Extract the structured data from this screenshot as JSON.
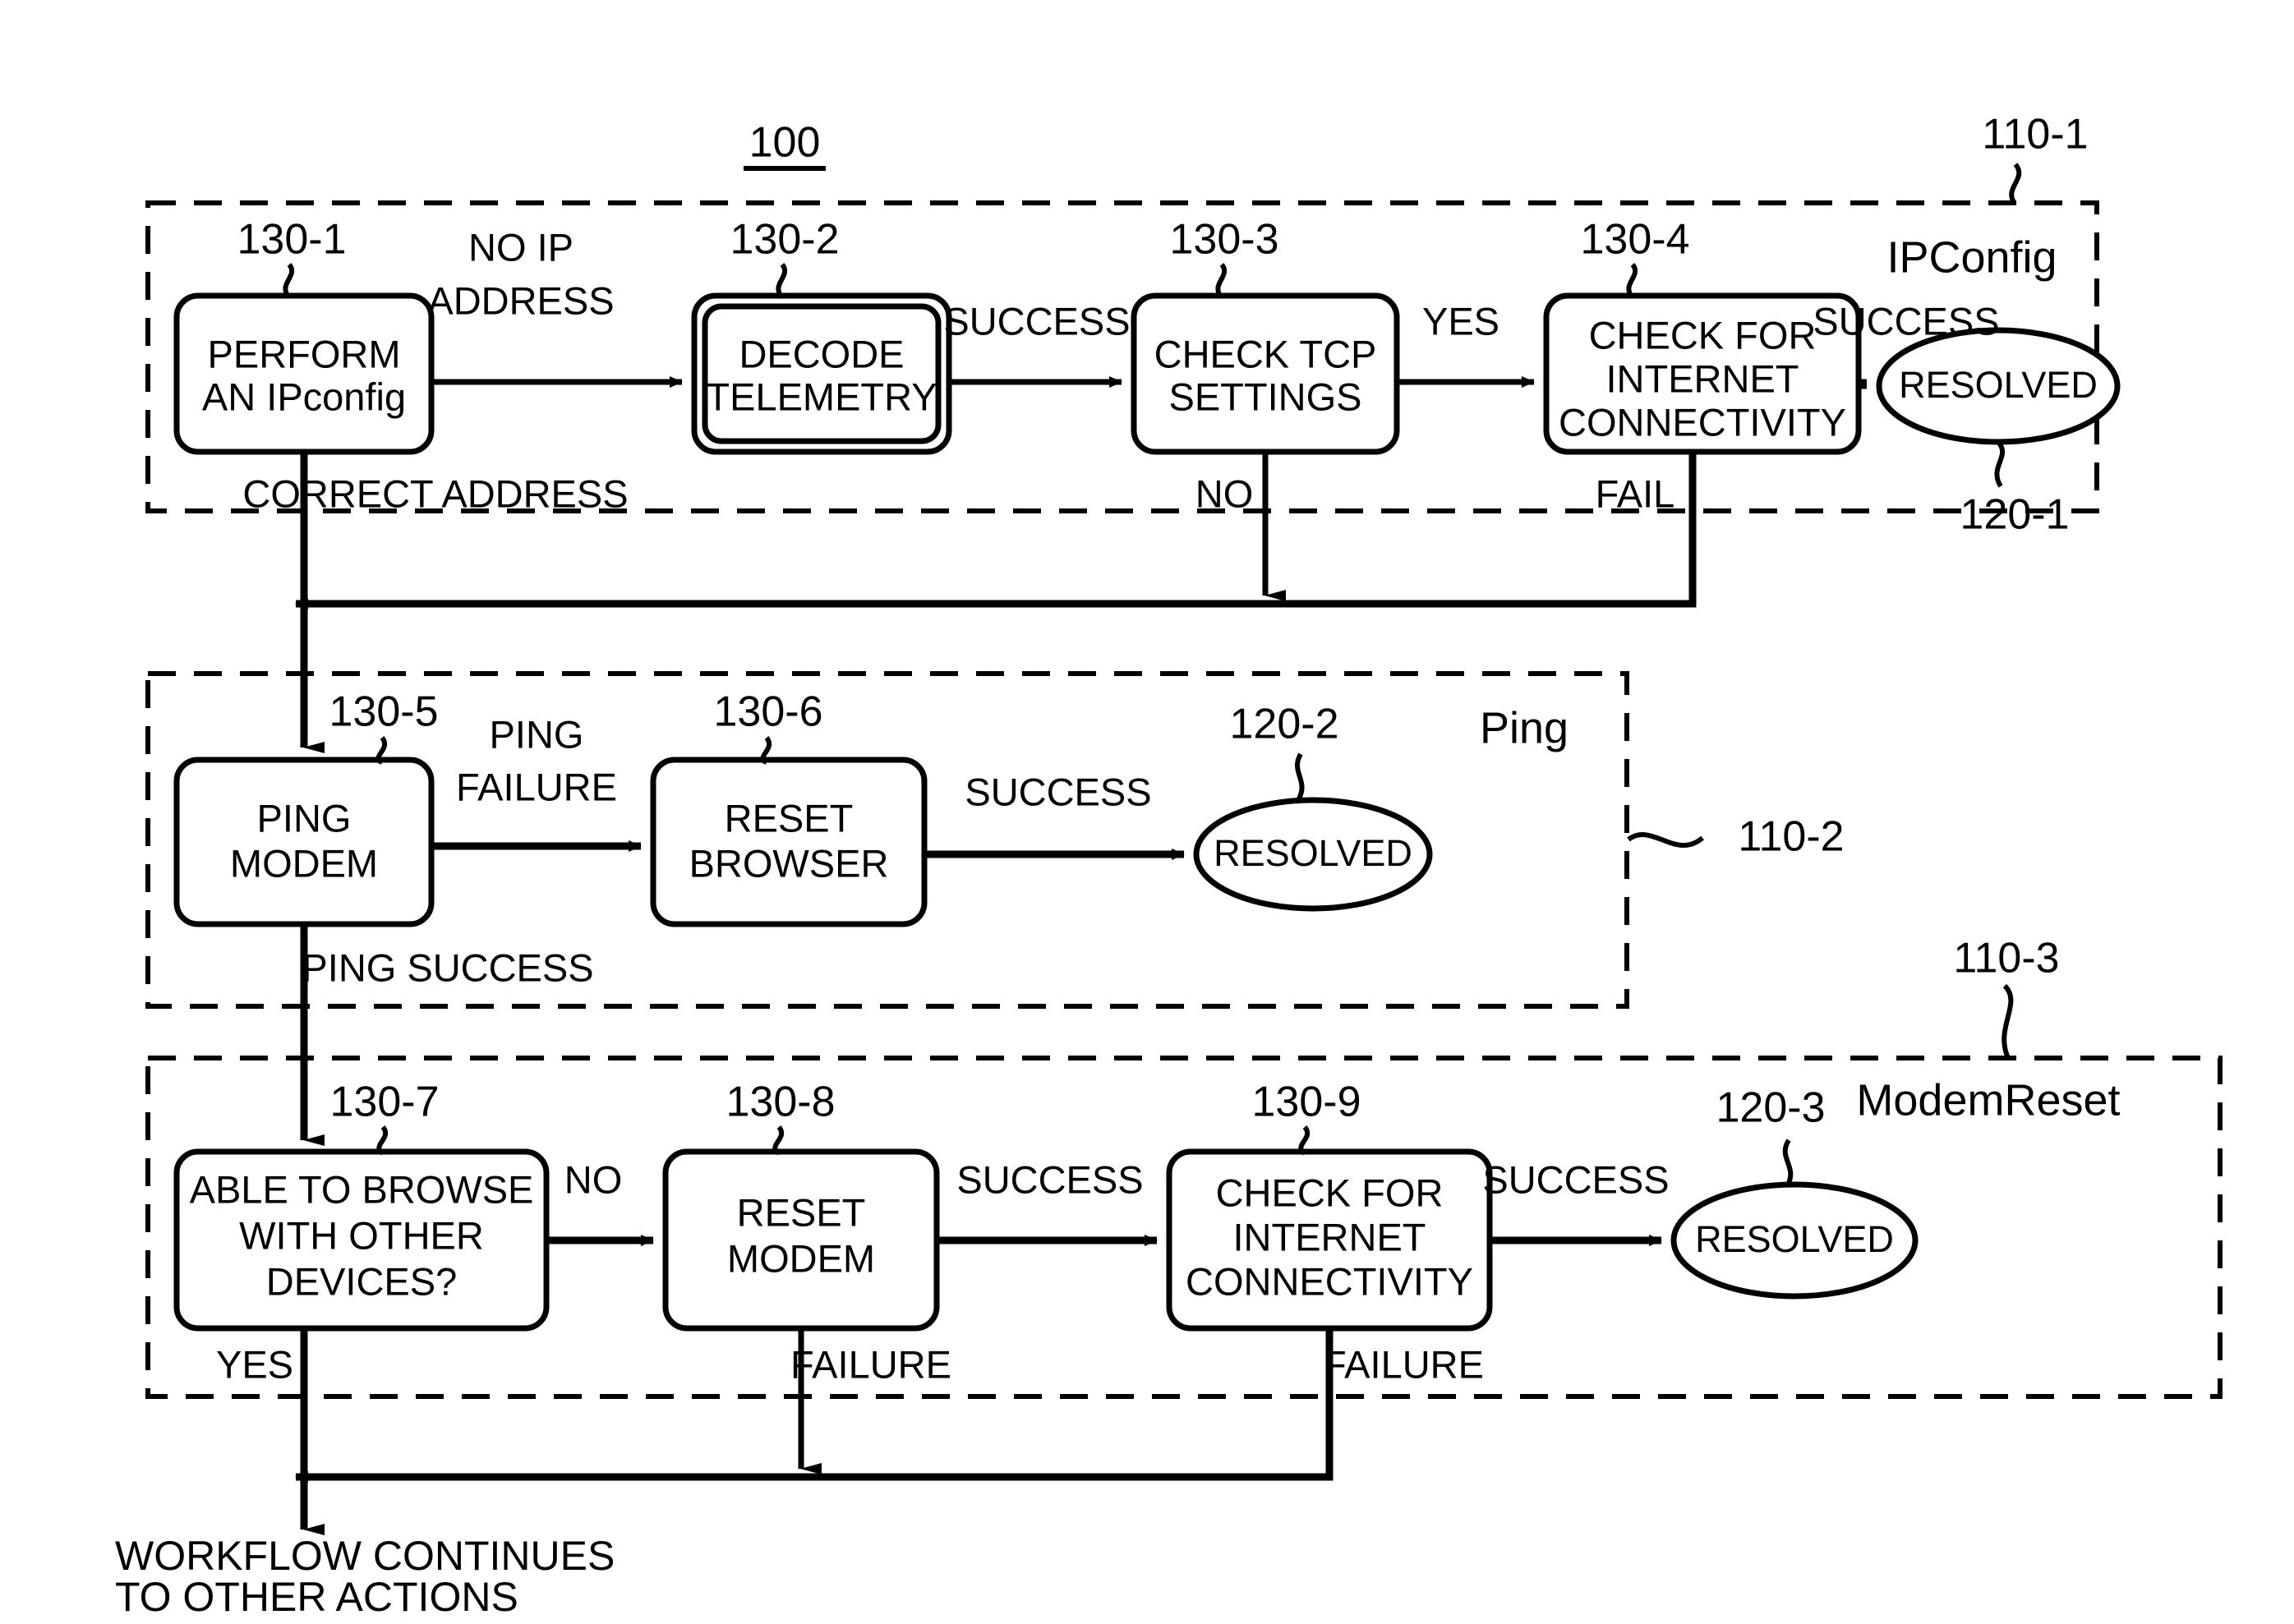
{
  "figure": {
    "number": "100",
    "title_label": "100"
  },
  "groups": [
    {
      "id": "ipconfig",
      "name": "IPConfig",
      "ref": "110-1"
    },
    {
      "id": "ping",
      "name": "Ping",
      "ref": "110-2"
    },
    {
      "id": "modemreset",
      "name": "ModemReset",
      "ref": "110-3"
    }
  ],
  "nodes": [
    {
      "id": "n1",
      "ref": "130-1",
      "lines": [
        "PERFORM",
        "AN IPconfig"
      ],
      "shape": "rounded-rect",
      "double": false
    },
    {
      "id": "n2",
      "ref": "130-2",
      "lines": [
        "DECODE",
        "TELEMETRY"
      ],
      "shape": "rounded-rect",
      "double": true
    },
    {
      "id": "n3",
      "ref": "130-3",
      "lines": [
        "CHECK TCP",
        "SETTINGS"
      ],
      "shape": "rounded-rect",
      "double": false
    },
    {
      "id": "n4",
      "ref": "130-4",
      "lines": [
        "CHECK FOR",
        "INTERNET",
        "CONNECTIVITY"
      ],
      "shape": "rounded-rect",
      "double": false
    },
    {
      "id": "n5",
      "ref": "130-5",
      "lines": [
        "PING",
        "MODEM"
      ],
      "shape": "rounded-rect",
      "double": false
    },
    {
      "id": "n6",
      "ref": "130-6",
      "lines": [
        "RESET",
        "BROWSER"
      ],
      "shape": "rounded-rect",
      "double": false
    },
    {
      "id": "n7",
      "ref": "130-7",
      "lines": [
        "ABLE TO BROWSE",
        "WITH OTHER",
        "DEVICES?"
      ],
      "shape": "rounded-rect",
      "double": false
    },
    {
      "id": "n8",
      "ref": "130-8",
      "lines": [
        "RESET",
        "MODEM"
      ],
      "shape": "rounded-rect",
      "double": false
    },
    {
      "id": "n9",
      "ref": "130-9",
      "lines": [
        "CHECK FOR",
        "INTERNET",
        "CONNECTIVITY"
      ],
      "shape": "rounded-rect",
      "double": false
    }
  ],
  "terminals": [
    {
      "id": "t1",
      "ref": "120-1",
      "label": "RESOLVED",
      "shape": "ellipse"
    },
    {
      "id": "t2",
      "ref": "120-2",
      "label": "RESOLVED",
      "shape": "ellipse"
    },
    {
      "id": "t3",
      "ref": "120-3",
      "label": "RESOLVED",
      "shape": "ellipse"
    }
  ],
  "edge_labels": {
    "no_ip_address_l1": "NO IP",
    "no_ip_address_l2": "ADDRESS",
    "correct_address": "CORRECT ADDRESS",
    "success_1": "SUCCESS",
    "yes_1": "YES",
    "no_1": "NO",
    "success_2": "SUCCESS",
    "fail_1": "FAIL",
    "ping_failure_l1": "PING",
    "ping_failure_l2": "FAILURE",
    "success_3": "SUCCESS",
    "ping_success": "PING SUCCESS",
    "no_2": "NO",
    "yes_2": "YES",
    "success_4": "SUCCESS",
    "failure_1": "FAILURE",
    "success_5": "SUCCESS",
    "failure_2": "FAILURE"
  },
  "footer": {
    "line1": "WORKFLOW CONTINUES",
    "line2": "TO OTHER ACTIONS"
  },
  "colors": {
    "stroke": "#000000",
    "background": "#ffffff"
  }
}
